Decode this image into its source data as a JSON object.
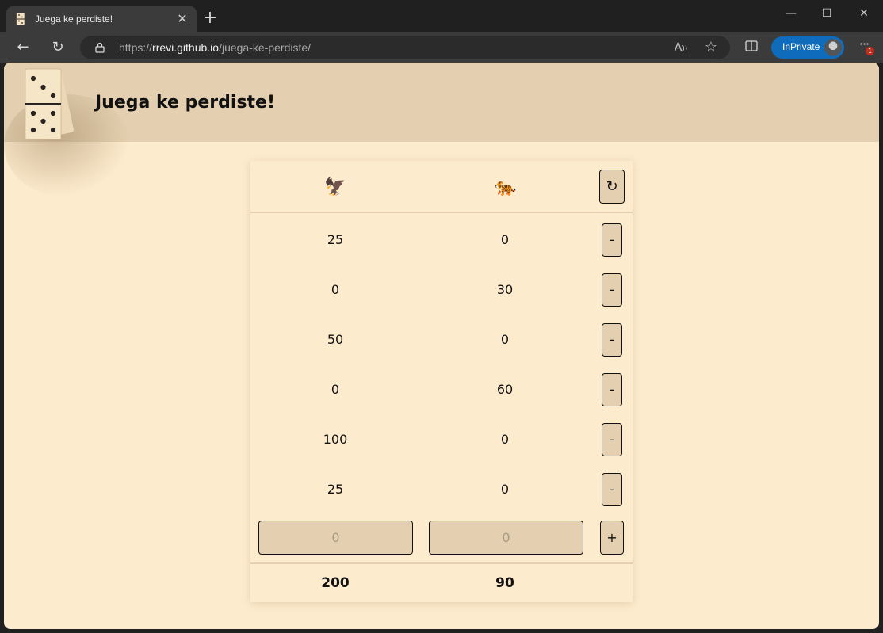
{
  "browser": {
    "tab_title": "Juega ke perdiste!",
    "url_prefix": "https://",
    "url_host": "rrevi.github.io",
    "url_path": "/juega-ke-perdiste/",
    "inprivate_label": "InPrivate",
    "notification_count": "1",
    "icons": {
      "favicon": "domino-icon",
      "close": "close-icon",
      "new_tab": "plus-icon",
      "back": "back-arrow-icon",
      "refresh": "refresh-icon",
      "lock": "lock-icon",
      "read_aloud": "read-aloud-icon",
      "favorite": "star-icon",
      "split": "split-screen-icon",
      "menu": "more-icon"
    }
  },
  "page": {
    "title": "Juega ke perdiste!",
    "logo": "domino-icon"
  },
  "scoreboard": {
    "teams": [
      {
        "icon": "🦅",
        "icon_name": "eagle-icon"
      },
      {
        "icon": "🐅",
        "icon_name": "tiger-icon"
      }
    ],
    "reset_label": "↻",
    "rounds": [
      {
        "a": "25",
        "b": "0"
      },
      {
        "a": "0",
        "b": "30"
      },
      {
        "a": "50",
        "b": "0"
      },
      {
        "a": "0",
        "b": "60"
      },
      {
        "a": "100",
        "b": "0"
      },
      {
        "a": "25",
        "b": "0"
      }
    ],
    "remove_label": "-",
    "input_placeholder_a": "0",
    "input_placeholder_b": "0",
    "add_label": "+",
    "totals": {
      "a": "200",
      "b": "90"
    }
  },
  "colors": {
    "page_bg": "#fdebcd",
    "header_bg": "#e4d0b0",
    "button_bg": "#e4d0b0",
    "inprivate": "#0f6cbd"
  }
}
